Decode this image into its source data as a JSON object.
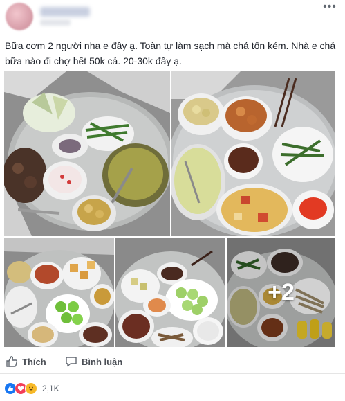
{
  "post": {
    "text": "Bữa cơm 2 người nha e đây ạ. Toàn tự làm sạch mà chả tốn kém. Nhà e chả bữa nào đi chợ hết 50k cả. 20-30k đây ạ."
  },
  "gallery": {
    "more_label": "+2"
  },
  "actions": {
    "like_label": "Thích",
    "comment_label": "Bình luận"
  },
  "reactions": {
    "count": "2,1K"
  },
  "colors": {
    "like_blue": "#1877f2",
    "love_red": "#f33e58",
    "haha_yellow": "#f7b928"
  }
}
